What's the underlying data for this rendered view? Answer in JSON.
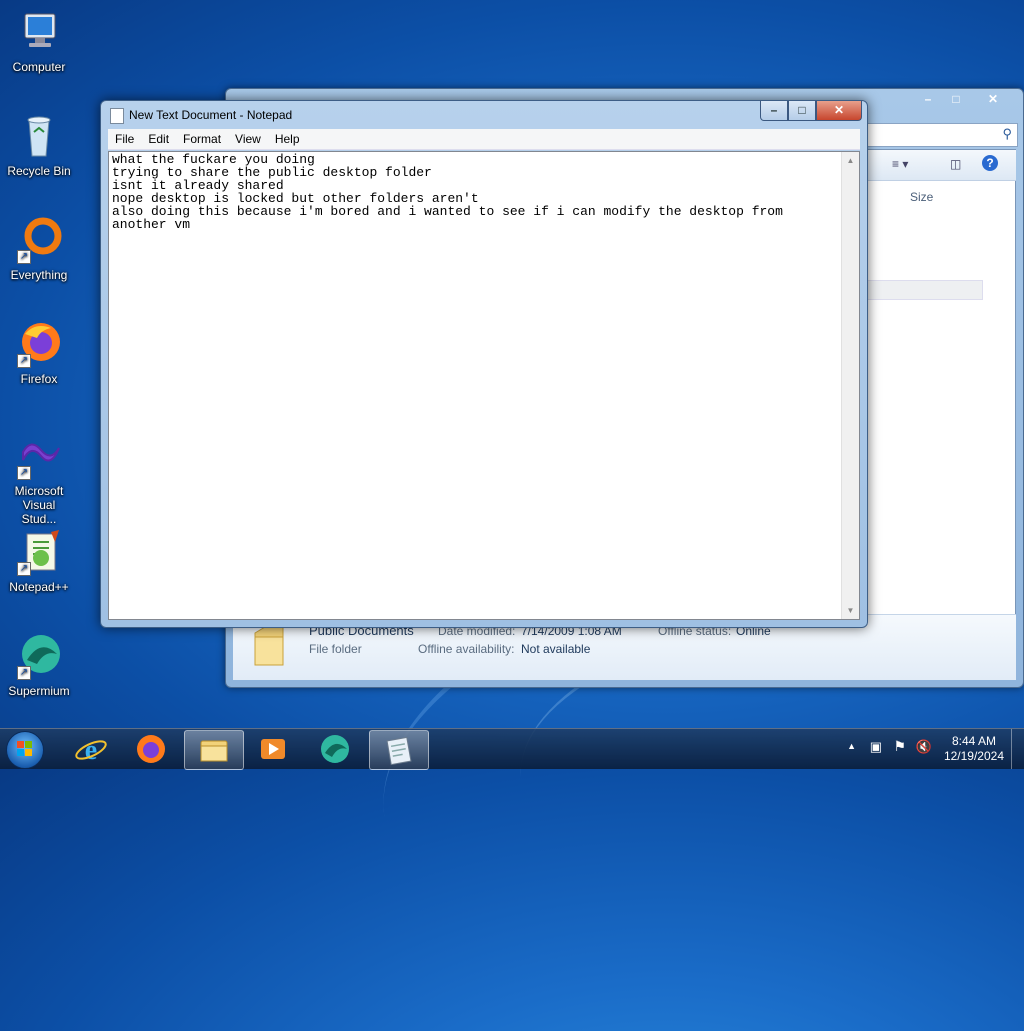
{
  "desktop": {
    "icons": [
      {
        "label": "Computer"
      },
      {
        "label": "Recycle Bin"
      },
      {
        "label": "Everything"
      },
      {
        "label": "Firefox"
      },
      {
        "label": "Microsoft Visual Stud..."
      },
      {
        "label": "Notepad++"
      },
      {
        "label": "Supermium"
      }
    ]
  },
  "explorer": {
    "column_size": "Size",
    "details": {
      "name": "Public Documents",
      "type": "File folder",
      "date_modified_label": "Date modified:",
      "date_modified": "7/14/2009 1:08 AM",
      "offline_status_label": "Offline status:",
      "offline_status": "Online",
      "offline_availability_label": "Offline availability:",
      "offline_availability": "Not available"
    }
  },
  "notepad": {
    "title": "New Text Document - Notepad",
    "menu": [
      "File",
      "Edit",
      "Format",
      "View",
      "Help"
    ],
    "content": "what the fuckare you doing\ntrying to share the public desktop folder\nisnt it already shared\nnope desktop is locked but other folders aren't\nalso doing this because i'm bored and i wanted to see if i can modify the desktop from\nanother vm"
  },
  "taskbar": {
    "time": "8:44 AM",
    "date": "12/19/2024"
  }
}
